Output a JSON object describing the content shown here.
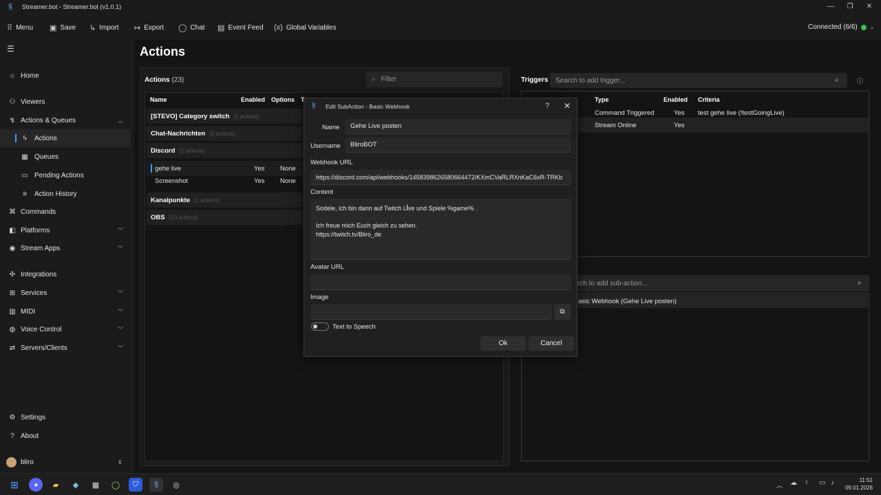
{
  "window": {
    "title": "Streamer.bot - Streamer.bot (v1.0.1)"
  },
  "toolbar": {
    "menu": "Menu",
    "save": "Save",
    "import": "Import",
    "export": "Export",
    "chat": "Chat",
    "event_feed": "Event Feed",
    "global_variables": "Global Variables",
    "connected": "Connected (6/6)"
  },
  "sidebar": {
    "items": [
      {
        "label": "Home",
        "icon": "home-icon"
      },
      {
        "label": "Viewers",
        "icon": "users-icon"
      },
      {
        "label": "Actions & Queues",
        "icon": "flow-icon"
      },
      {
        "label": "Actions",
        "icon": "bolt-icon"
      },
      {
        "label": "Queues",
        "icon": "queue-icon"
      },
      {
        "label": "Pending Actions",
        "icon": "pending-icon"
      },
      {
        "label": "Action History",
        "icon": "history-icon"
      },
      {
        "label": "Commands",
        "icon": "command-icon"
      },
      {
        "label": "Platforms",
        "icon": "platforms-icon"
      },
      {
        "label": "Stream Apps",
        "icon": "apps-icon"
      },
      {
        "label": "Integrations",
        "icon": "integrations-icon"
      },
      {
        "label": "Services",
        "icon": "services-icon"
      },
      {
        "label": "MIDI",
        "icon": "midi-icon"
      },
      {
        "label": "Voice Control",
        "icon": "voice-icon"
      },
      {
        "label": "Servers/Clients",
        "icon": "server-icon"
      },
      {
        "label": "Settings",
        "icon": "settings-icon"
      },
      {
        "label": "About",
        "icon": "about-icon"
      }
    ],
    "user": "bliro"
  },
  "page": {
    "title": "Actions"
  },
  "actions": {
    "label": "Actions",
    "count": "(23)",
    "filter_placeholder": "Filter",
    "columns": [
      "Name",
      "Enabled",
      "Options",
      "T"
    ],
    "groups": [
      {
        "name": "[STEVO] Category switch",
        "count": "(1 actions)"
      },
      {
        "name": "Chat-Nachrichten",
        "count": "(3 actions)"
      },
      {
        "name": "Discord",
        "count": "(2 actions)"
      },
      {
        "name": "Kanalpunkte",
        "count": "(2 actions)"
      },
      {
        "name": "OBS",
        "count": "(10 actions)"
      }
    ],
    "rows": [
      {
        "name": "gehe live",
        "enabled": "Yes",
        "options": "None"
      },
      {
        "name": "Screenshot",
        "enabled": "Yes",
        "options": "None"
      }
    ]
  },
  "triggers": {
    "label": "Triggers",
    "search_placeholder": "Search to add trigger...",
    "columns": [
      "Type",
      "Enabled",
      "Criteria"
    ],
    "rows": [
      {
        "type": "Command Triggered",
        "enabled": "Yes",
        "criteria": "test gehe live (!testGoingLive)"
      },
      {
        "type": "Stream Online",
        "enabled": "Yes",
        "criteria": ""
      }
    ]
  },
  "subactions": {
    "search_placeholder": "rch to add sub-action...",
    "item": "asic Webhook (Gehe Live posten)"
  },
  "dialog": {
    "title": "Edit SubAction - Basic Webhook",
    "name_label": "Name",
    "name_value": "Gehe Live posten",
    "username_label": "Username",
    "username_value": "BliroBOT",
    "webhook_label": "Webhook URL",
    "webhook_value": "https://discord.com/api/webhooks/1458398626580664472/KXmCVaRLRXnKaC6xR-TRKb",
    "content_label": "Content",
    "content_lines": [
      "Sodele, ich bin dann auf Twitch Live und Spiele %game% .",
      "",
      "Ich freue mich Euch gleich zu sehen.",
      "https://twitch.tv/Bliro_de"
    ],
    "avatar_label": "Avatar URL",
    "avatar_value": "",
    "image_label": "Image",
    "image_value": "",
    "tts_label": "Text to Speech",
    "ok": "Ok",
    "cancel": "Cancel"
  },
  "taskbar": {
    "time": "11:51",
    "date": "09.01.2026"
  },
  "colors": {
    "accent": "#3ea1ff",
    "connected": "#3fbf4a"
  }
}
